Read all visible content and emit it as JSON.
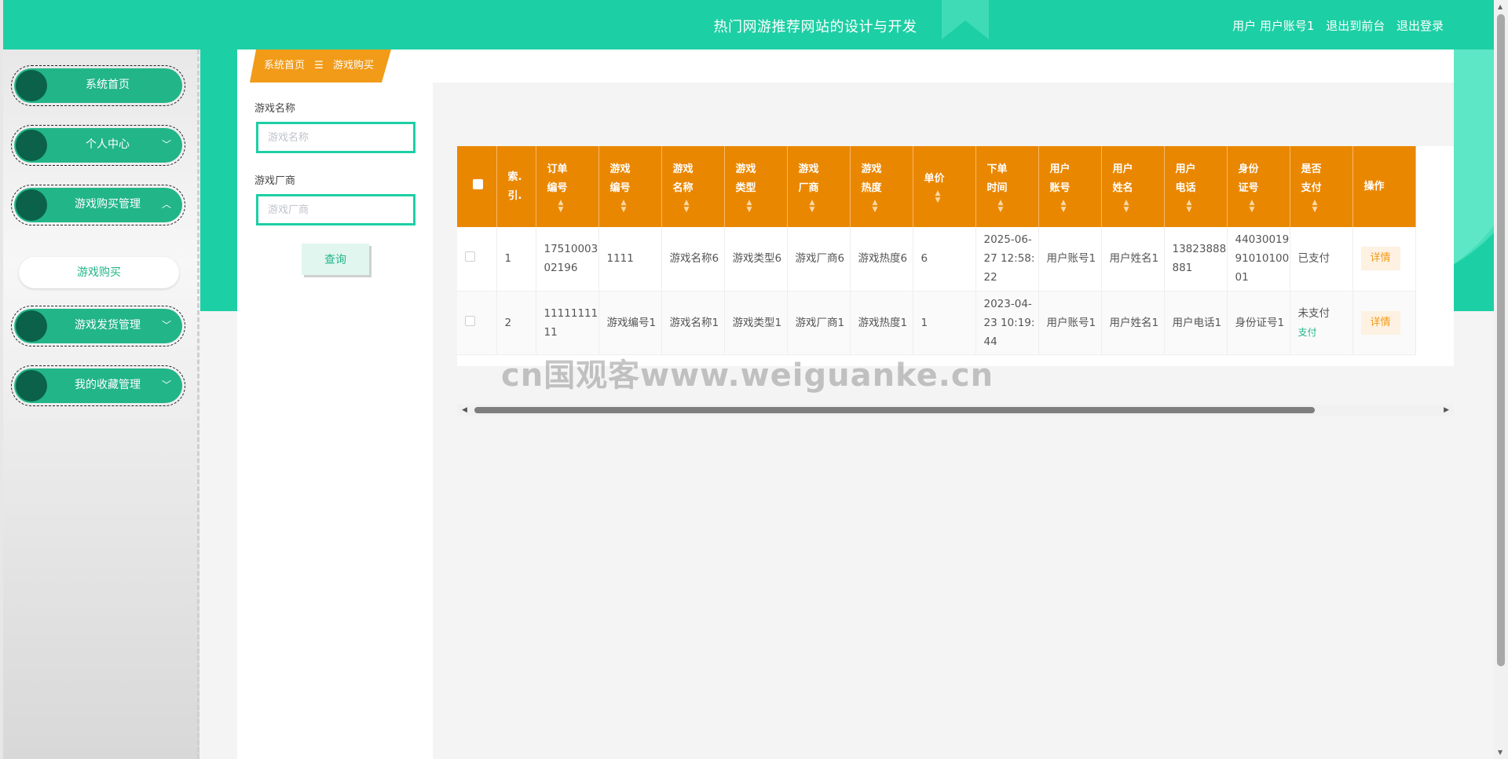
{
  "header": {
    "title": "热门网游推荐网站的设计与开发",
    "user_label": "用户 用户账号1",
    "to_front": "退出到前台",
    "logout": "退出登录"
  },
  "sidebar": {
    "items": [
      {
        "label": "系统首页",
        "chevron": ""
      },
      {
        "label": "个人中心",
        "chevron": "﹀"
      },
      {
        "label": "游戏购买管理",
        "chevron": "︿"
      },
      {
        "label": "游戏发货管理",
        "chevron": "﹀"
      },
      {
        "label": "我的收藏管理",
        "chevron": "﹀"
      }
    ],
    "sub_item": "游戏购买"
  },
  "breadcrumb": {
    "home": "系统首页",
    "separator": "☰",
    "current": "游戏购买"
  },
  "search": {
    "game_name_label": "游戏名称",
    "game_name_placeholder": "游戏名称",
    "vendor_label": "游戏厂商",
    "vendor_placeholder": "游戏厂商",
    "query_button": "查询"
  },
  "table": {
    "headers": [
      "索引",
      "订单编号",
      "游戏编号",
      "游戏名称",
      "游戏类型",
      "游戏厂商",
      "游戏热度",
      "单价",
      "下单时间",
      "用户账号",
      "用户姓名",
      "用户电话",
      "身份证号",
      "是否支付",
      "操作"
    ],
    "header_lines": [
      [
        "索.",
        "引."
      ],
      [
        "订单",
        "编号"
      ],
      [
        "游戏",
        "编号"
      ],
      [
        "游戏",
        "名称"
      ],
      [
        "游戏",
        "类型"
      ],
      [
        "游戏",
        "厂商"
      ],
      [
        "游戏",
        "热度"
      ],
      [
        "单价",
        ""
      ],
      [
        "下单",
        "时间"
      ],
      [
        "用户",
        "账号"
      ],
      [
        "用户",
        "姓名"
      ],
      [
        "用户",
        "电话"
      ],
      [
        "身份",
        "证号"
      ],
      [
        "是否",
        "支付"
      ],
      [
        "操作",
        ""
      ]
    ],
    "rows": [
      {
        "index": "1",
        "order_no": "1751000302196",
        "game_no": "1111",
        "game_name": "游戏名称6",
        "game_type": "游戏类型6",
        "vendor": "游戏厂商6",
        "heat": "游戏热度6",
        "price": "6",
        "order_time": "2025-06-27 12:58:22",
        "account": "用户账号1",
        "name": "用户姓名1",
        "phone": "13823888881",
        "id_no": "440300199101010001",
        "paid": "已支付",
        "pay_link": "",
        "action": "详情"
      },
      {
        "index": "2",
        "order_no": "1111111111",
        "game_no": "游戏编号1",
        "game_name": "游戏名称1",
        "game_type": "游戏类型1",
        "vendor": "游戏厂商1",
        "heat": "游戏热度1",
        "price": "1",
        "order_time": "2023-04-23 10:19:44",
        "account": "用户账号1",
        "name": "用户姓名1",
        "phone": "用户电话1",
        "id_no": "身份证号1",
        "paid": "未支付",
        "pay_link": "支付",
        "action": "详情"
      }
    ]
  },
  "watermark": "cn国观客www.weiguanke.cn",
  "colors": {
    "primary_green": "#1dcfa4",
    "menu_green": "#22b588",
    "table_header": "#ea8700",
    "breadcrumb_orange": "#f29b18"
  }
}
